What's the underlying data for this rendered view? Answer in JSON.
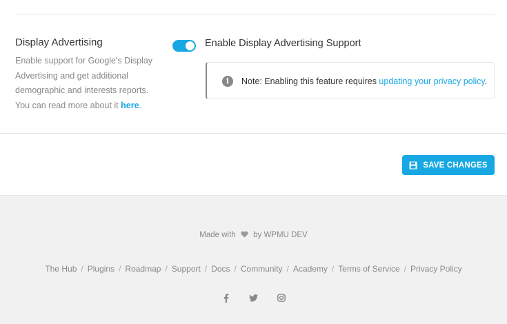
{
  "section": {
    "title": "Display Advertising",
    "description": "Enable support for Google's Display Advertising and get additional demographic and interests reports. You can read more about it ",
    "link_text": "here",
    "period": "."
  },
  "option": {
    "label": "Enable Display Advertising Support",
    "enabled": true
  },
  "notice": {
    "text": "Note: Enabling this feature requires ",
    "link_text": "updating your privacy policy",
    "suffix": "."
  },
  "actions": {
    "save_label": "SAVE CHANGES"
  },
  "footer": {
    "made_with_prefix": "Made with",
    "made_with_suffix": "by WPMU DEV",
    "nav": [
      "The Hub",
      "Plugins",
      "Roadmap",
      "Support",
      "Docs",
      "Community",
      "Academy",
      "Terms of Service",
      "Privacy Policy"
    ],
    "separator": "/",
    "social": [
      "facebook-icon",
      "twitter-icon",
      "instagram-icon"
    ]
  },
  "colors": {
    "accent": "#17a8e3",
    "muted": "#888888",
    "footer_bg": "#f1f1f1"
  }
}
